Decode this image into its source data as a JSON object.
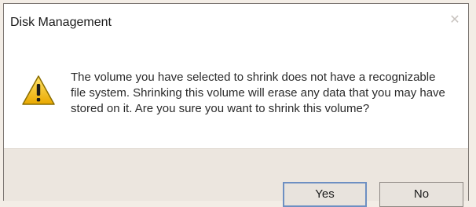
{
  "window": {
    "title": "Disk Management",
    "close_glyph": "✕"
  },
  "dialog": {
    "icon": "warning-icon",
    "message": "The volume you have selected to shrink does not have a recognizable file system. Shrinking this volume will erase any data that you may have stored on it. Are you sure you want to shrink this volume?"
  },
  "buttons": {
    "yes_label": "Yes",
    "no_label": "No"
  },
  "colors": {
    "warning_fill": "#f5c518",
    "warning_outline": "#8a6d00",
    "focus_border": "#6d8fc2"
  }
}
